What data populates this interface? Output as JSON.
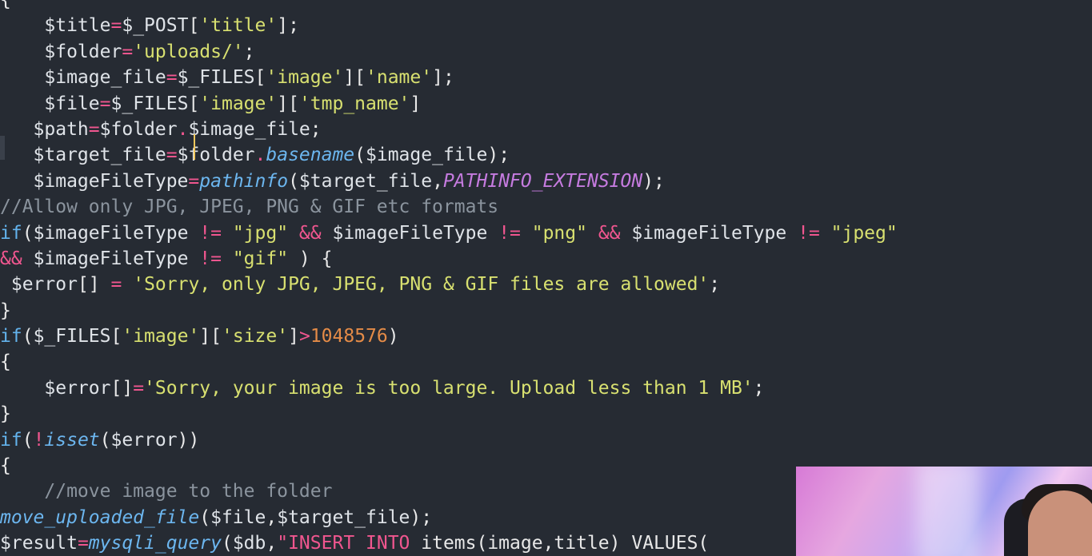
{
  "editor": {
    "lines": [
      [
        {
          "t": "{",
          "c": "t-p"
        }
      ],
      [
        {
          "t": "    ",
          "c": "t-p"
        },
        {
          "t": "$title",
          "c": "t-var"
        },
        {
          "t": "=",
          "c": "t-op"
        },
        {
          "t": "$_POST",
          "c": "t-var"
        },
        {
          "t": "[",
          "c": "t-p"
        },
        {
          "t": "'title'",
          "c": "t-str"
        },
        {
          "t": "];",
          "c": "t-p"
        }
      ],
      [
        {
          "t": "    ",
          "c": "t-p"
        },
        {
          "t": "$folder",
          "c": "t-var"
        },
        {
          "t": "=",
          "c": "t-op"
        },
        {
          "t": "'uploads/'",
          "c": "t-str"
        },
        {
          "t": ";",
          "c": "t-p"
        }
      ],
      [
        {
          "t": "    ",
          "c": "t-p"
        },
        {
          "t": "$image_file",
          "c": "t-var"
        },
        {
          "t": "=",
          "c": "t-op"
        },
        {
          "t": "$_FILES",
          "c": "t-var"
        },
        {
          "t": "[",
          "c": "t-p"
        },
        {
          "t": "'image'",
          "c": "t-str"
        },
        {
          "t": "][",
          "c": "t-p"
        },
        {
          "t": "'name'",
          "c": "t-str"
        },
        {
          "t": "];",
          "c": "t-p"
        }
      ],
      [
        {
          "t": "    ",
          "c": "t-p"
        },
        {
          "t": "$file",
          "c": "t-var"
        },
        {
          "t": "=",
          "c": "t-op"
        },
        {
          "t": "$_FILES",
          "c": "t-var"
        },
        {
          "t": "[",
          "c": "t-p"
        },
        {
          "t": "'image'",
          "c": "t-str"
        },
        {
          "t": "][",
          "c": "t-p"
        },
        {
          "t": "'tmp_name'",
          "c": "t-str"
        },
        {
          "t": "]",
          "c": "t-p"
        }
      ],
      [
        {
          "t": "   ",
          "c": "t-p"
        },
        {
          "t": "$path",
          "c": "t-var"
        },
        {
          "t": "=",
          "c": "t-op"
        },
        {
          "t": "$folder",
          "c": "t-var"
        },
        {
          "t": ".",
          "c": "t-op"
        },
        {
          "t": "$image_file",
          "c": "t-var"
        },
        {
          "t": ";",
          "c": "t-p"
        }
      ],
      [
        {
          "t": "   ",
          "c": "t-p"
        },
        {
          "t": "$target_file",
          "c": "t-var"
        },
        {
          "t": "=",
          "c": "t-op"
        },
        {
          "t": "$folder",
          "c": "t-var"
        },
        {
          "t": ".",
          "c": "t-op"
        },
        {
          "t": "basename",
          "c": "t-fn"
        },
        {
          "t": "(",
          "c": "t-p"
        },
        {
          "t": "$image_file",
          "c": "t-var"
        },
        {
          "t": ");",
          "c": "t-p"
        }
      ],
      [
        {
          "t": "   ",
          "c": "t-p"
        },
        {
          "t": "$imageFileType",
          "c": "t-var"
        },
        {
          "t": "=",
          "c": "t-op"
        },
        {
          "t": "pathinfo",
          "c": "t-fn"
        },
        {
          "t": "(",
          "c": "t-p"
        },
        {
          "t": "$target_file",
          "c": "t-var"
        },
        {
          "t": ",",
          "c": "t-p"
        },
        {
          "t": "PATHINFO_EXTENSION",
          "c": "t-const"
        },
        {
          "t": ");",
          "c": "t-p"
        }
      ],
      [
        {
          "t": "//Allow only JPG, JPEG, PNG & GIF etc formats",
          "c": "t-cmt"
        }
      ],
      [
        {
          "t": "if",
          "c": "t-kw"
        },
        {
          "t": "(",
          "c": "t-p"
        },
        {
          "t": "$imageFileType",
          "c": "t-var"
        },
        {
          "t": " != ",
          "c": "t-op"
        },
        {
          "t": "\"jpg\"",
          "c": "t-str"
        },
        {
          "t": " && ",
          "c": "t-op"
        },
        {
          "t": "$imageFileType",
          "c": "t-var"
        },
        {
          "t": " != ",
          "c": "t-op"
        },
        {
          "t": "\"png\"",
          "c": "t-str"
        },
        {
          "t": " && ",
          "c": "t-op"
        },
        {
          "t": "$imageFileType",
          "c": "t-var"
        },
        {
          "t": " != ",
          "c": "t-op"
        },
        {
          "t": "\"jpeg\"",
          "c": "t-str"
        }
      ],
      [
        {
          "t": "&&",
          "c": "t-op"
        },
        {
          "t": " ",
          "c": "t-p"
        },
        {
          "t": "$imageFileType",
          "c": "t-var"
        },
        {
          "t": " != ",
          "c": "t-op"
        },
        {
          "t": "\"gif\"",
          "c": "t-str"
        },
        {
          "t": " ) {",
          "c": "t-p"
        }
      ],
      [
        {
          "t": " ",
          "c": "t-p"
        },
        {
          "t": "$error",
          "c": "t-var"
        },
        {
          "t": "[] ",
          "c": "t-p"
        },
        {
          "t": "=",
          "c": "t-op"
        },
        {
          "t": " ",
          "c": "t-p"
        },
        {
          "t": "'Sorry, only JPG, JPEG, PNG & GIF files are allowed'",
          "c": "t-str"
        },
        {
          "t": ";",
          "c": "t-p"
        }
      ],
      [
        {
          "t": "}",
          "c": "t-p"
        }
      ],
      [
        {
          "t": "if",
          "c": "t-kw"
        },
        {
          "t": "(",
          "c": "t-p"
        },
        {
          "t": "$_FILES",
          "c": "t-var"
        },
        {
          "t": "[",
          "c": "t-p"
        },
        {
          "t": "'image'",
          "c": "t-str"
        },
        {
          "t": "][",
          "c": "t-p"
        },
        {
          "t": "'size'",
          "c": "t-str"
        },
        {
          "t": "]",
          "c": "t-p"
        },
        {
          "t": ">",
          "c": "t-op"
        },
        {
          "t": "1048576",
          "c": "t-num"
        },
        {
          "t": ")",
          "c": "t-p"
        }
      ],
      [
        {
          "t": "{",
          "c": "t-p"
        }
      ],
      [
        {
          "t": "    ",
          "c": "t-p"
        },
        {
          "t": "$error",
          "c": "t-var"
        },
        {
          "t": "[]",
          "c": "t-p"
        },
        {
          "t": "=",
          "c": "t-op"
        },
        {
          "t": "'Sorry, your image is too large. Upload less than 1 MB'",
          "c": "t-str"
        },
        {
          "t": ";",
          "c": "t-p"
        }
      ],
      [
        {
          "t": "}",
          "c": "t-p"
        }
      ],
      [
        {
          "t": "if",
          "c": "t-kw"
        },
        {
          "t": "(",
          "c": "t-p"
        },
        {
          "t": "!",
          "c": "t-not"
        },
        {
          "t": "isset",
          "c": "t-fn"
        },
        {
          "t": "(",
          "c": "t-p"
        },
        {
          "t": "$error",
          "c": "t-var"
        },
        {
          "t": "))",
          "c": "t-p"
        }
      ],
      [
        {
          "t": "{",
          "c": "t-p"
        }
      ],
      [
        {
          "t": "    //move image to the folder",
          "c": "t-cmt"
        }
      ],
      [
        {
          "t": "move_uploaded_file",
          "c": "t-fn"
        },
        {
          "t": "(",
          "c": "t-p"
        },
        {
          "t": "$file",
          "c": "t-var"
        },
        {
          "t": ",",
          "c": "t-p"
        },
        {
          "t": "$target_file",
          "c": "t-var"
        },
        {
          "t": ");",
          "c": "t-p"
        }
      ],
      [
        {
          "t": "$result",
          "c": "t-var"
        },
        {
          "t": "=",
          "c": "t-op"
        },
        {
          "t": "mysqli_query",
          "c": "t-fn"
        },
        {
          "t": "(",
          "c": "t-p"
        },
        {
          "t": "$db",
          "c": "t-var"
        },
        {
          "t": ",",
          "c": "t-p"
        },
        {
          "t": "\"INSERT INTO ",
          "c": "t-op"
        },
        {
          "t": "items(image,title) VALUES(",
          "c": "t-p"
        }
      ],
      [
        {
          "t": "   ?>",
          "c": "t-p"
        }
      ]
    ]
  },
  "colors": {
    "background": "#262b33",
    "variable": "#dfe3e8",
    "operator": "#f0568f",
    "string": "#d8e070",
    "number": "#e48b47",
    "keyword": "#63b3ed",
    "function": "#6cb6ef",
    "constant": "#c57bdf",
    "comment": "#8b949e",
    "cursor": "#f2c75c"
  }
}
